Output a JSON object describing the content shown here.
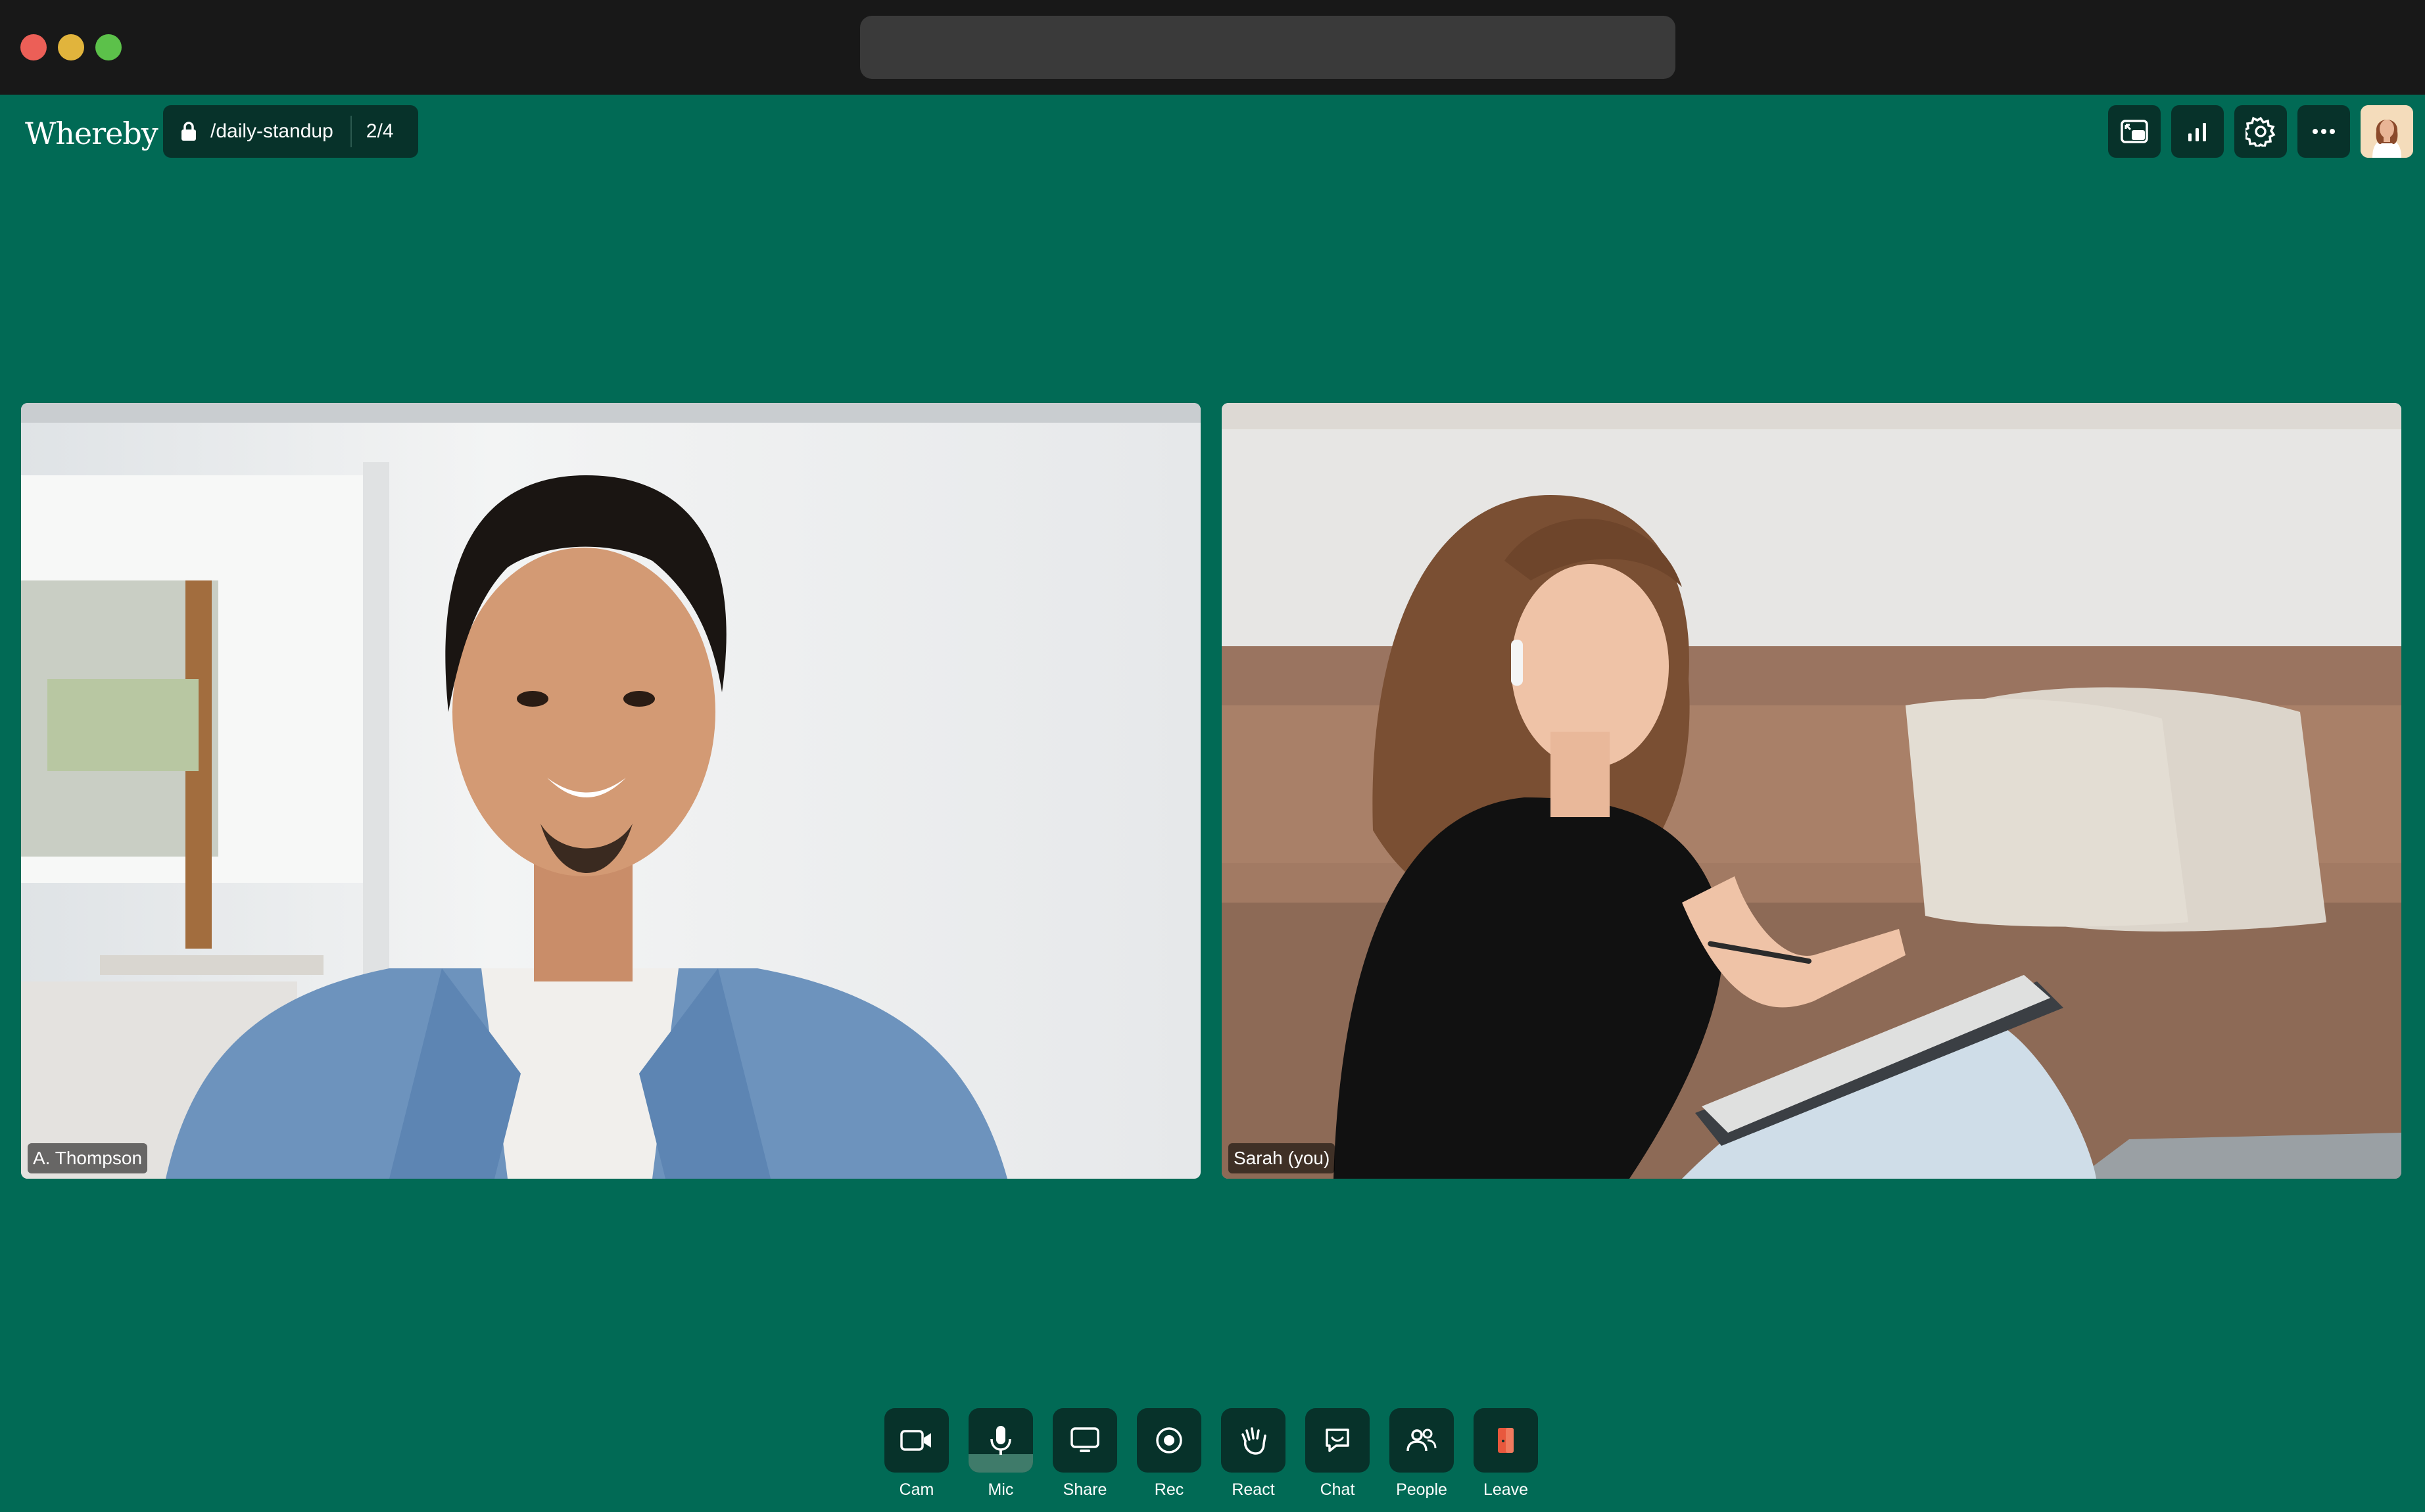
{
  "header": {
    "logo": "Whereby",
    "room_name": "/daily-standup",
    "participant_count": "2/4"
  },
  "top_actions": [
    {
      "icon": "picture-in-picture-icon"
    },
    {
      "icon": "stats-icon"
    },
    {
      "icon": "gear-icon"
    },
    {
      "icon": "more-icon"
    }
  ],
  "participants": [
    {
      "name": "A. Thompson"
    },
    {
      "name": "Sarah (you)"
    }
  ],
  "toolbar": {
    "cam": "Cam",
    "mic": "Mic",
    "share": "Share",
    "rec": "Rec",
    "react": "React",
    "chat": "Chat",
    "people": "People",
    "leave": "Leave"
  },
  "colors": {
    "background": "#016a55",
    "button_bg": "#07322a",
    "leave_accent": "#e8583d"
  }
}
